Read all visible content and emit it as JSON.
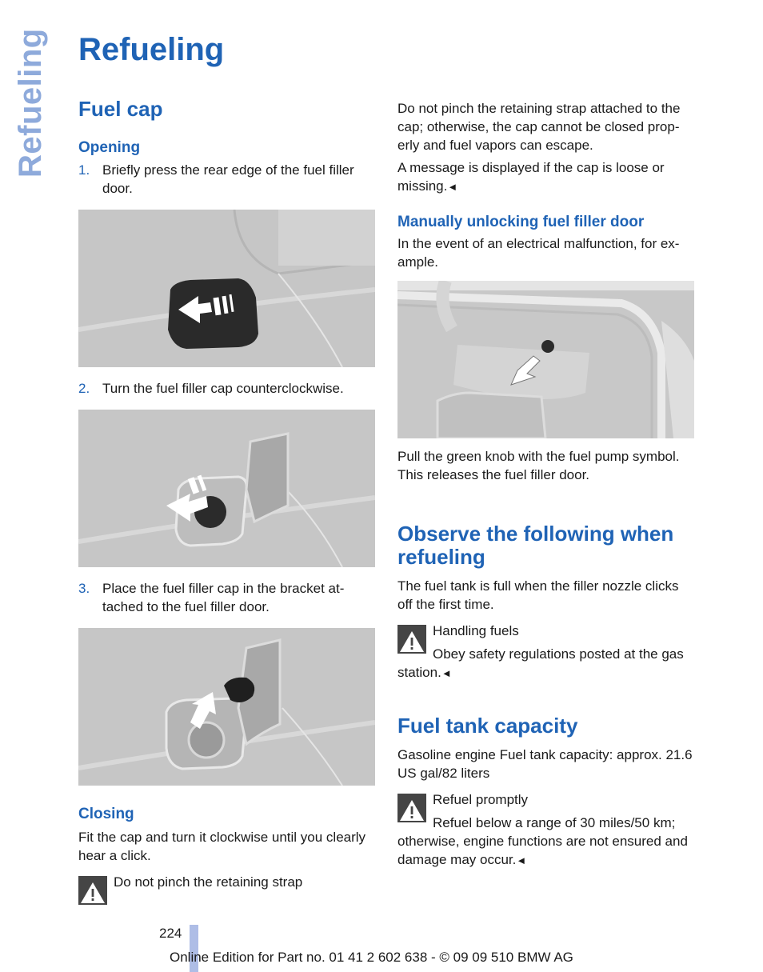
{
  "side_label": "Refueling",
  "page_title": "Refueling",
  "left": {
    "section_title": "Fuel cap",
    "opening": {
      "title": "Opening",
      "steps": [
        {
          "num": "1.",
          "text": "Briefly press the rear edge of the fuel filler door."
        },
        {
          "num": "2.",
          "text": "Turn the fuel filler cap counterclockwise."
        },
        {
          "num": "3.",
          "text": "Place the fuel filler cap in the bracket at-tached to the fuel filler door."
        }
      ],
      "figures": [
        {
          "alt": "Pressing the rear edge of the fuel filler door"
        },
        {
          "alt": "Turning the fuel filler cap counterclockwise"
        },
        {
          "alt": "Placing the cap in the bracket on the fuel filler door"
        }
      ]
    },
    "closing": {
      "title": "Closing",
      "text": "Fit the cap and turn it clockwise until you clearly hear a click.",
      "warning_title": "Do not pinch the retaining strap"
    }
  },
  "right": {
    "warning_continued": "Do not pinch the retaining strap attached to the cap; otherwise, the cap cannot be closed prop-erly and fuel vapors can escape.",
    "warning_message": "A message is displayed if the cap is loose or missing.",
    "end_mark": "◄",
    "manual_unlock": {
      "title": "Manually unlocking fuel filler door",
      "intro": "In the event of an electrical malfunction, for ex-ample.",
      "figure_alt": "Green knob with arrow inside luggage compartment",
      "instruction": "Pull the green knob with the fuel pump symbol. This releases the fuel filler door."
    },
    "observe": {
      "title": "Observe the following when refueling",
      "text": "The fuel tank is full when the filler nozzle clicks off the first time.",
      "warning_title": "Handling fuels",
      "warning_text": "Obey safety regulations posted at the gas station."
    },
    "capacity": {
      "title": "Fuel tank capacity",
      "text": "Gasoline engine Fuel tank capacity: approx. 21.6 US gal/82 liters",
      "warning_title": "Refuel promptly",
      "warning_text": "Refuel below a range of 30 miles/50 km; otherwise, engine functions are not ensured and damage may occur."
    }
  },
  "footer": {
    "page_number": "224",
    "edition": "Online Edition for Part no. 01 41 2 602 638 - © 09 09 510 BMW AG"
  }
}
